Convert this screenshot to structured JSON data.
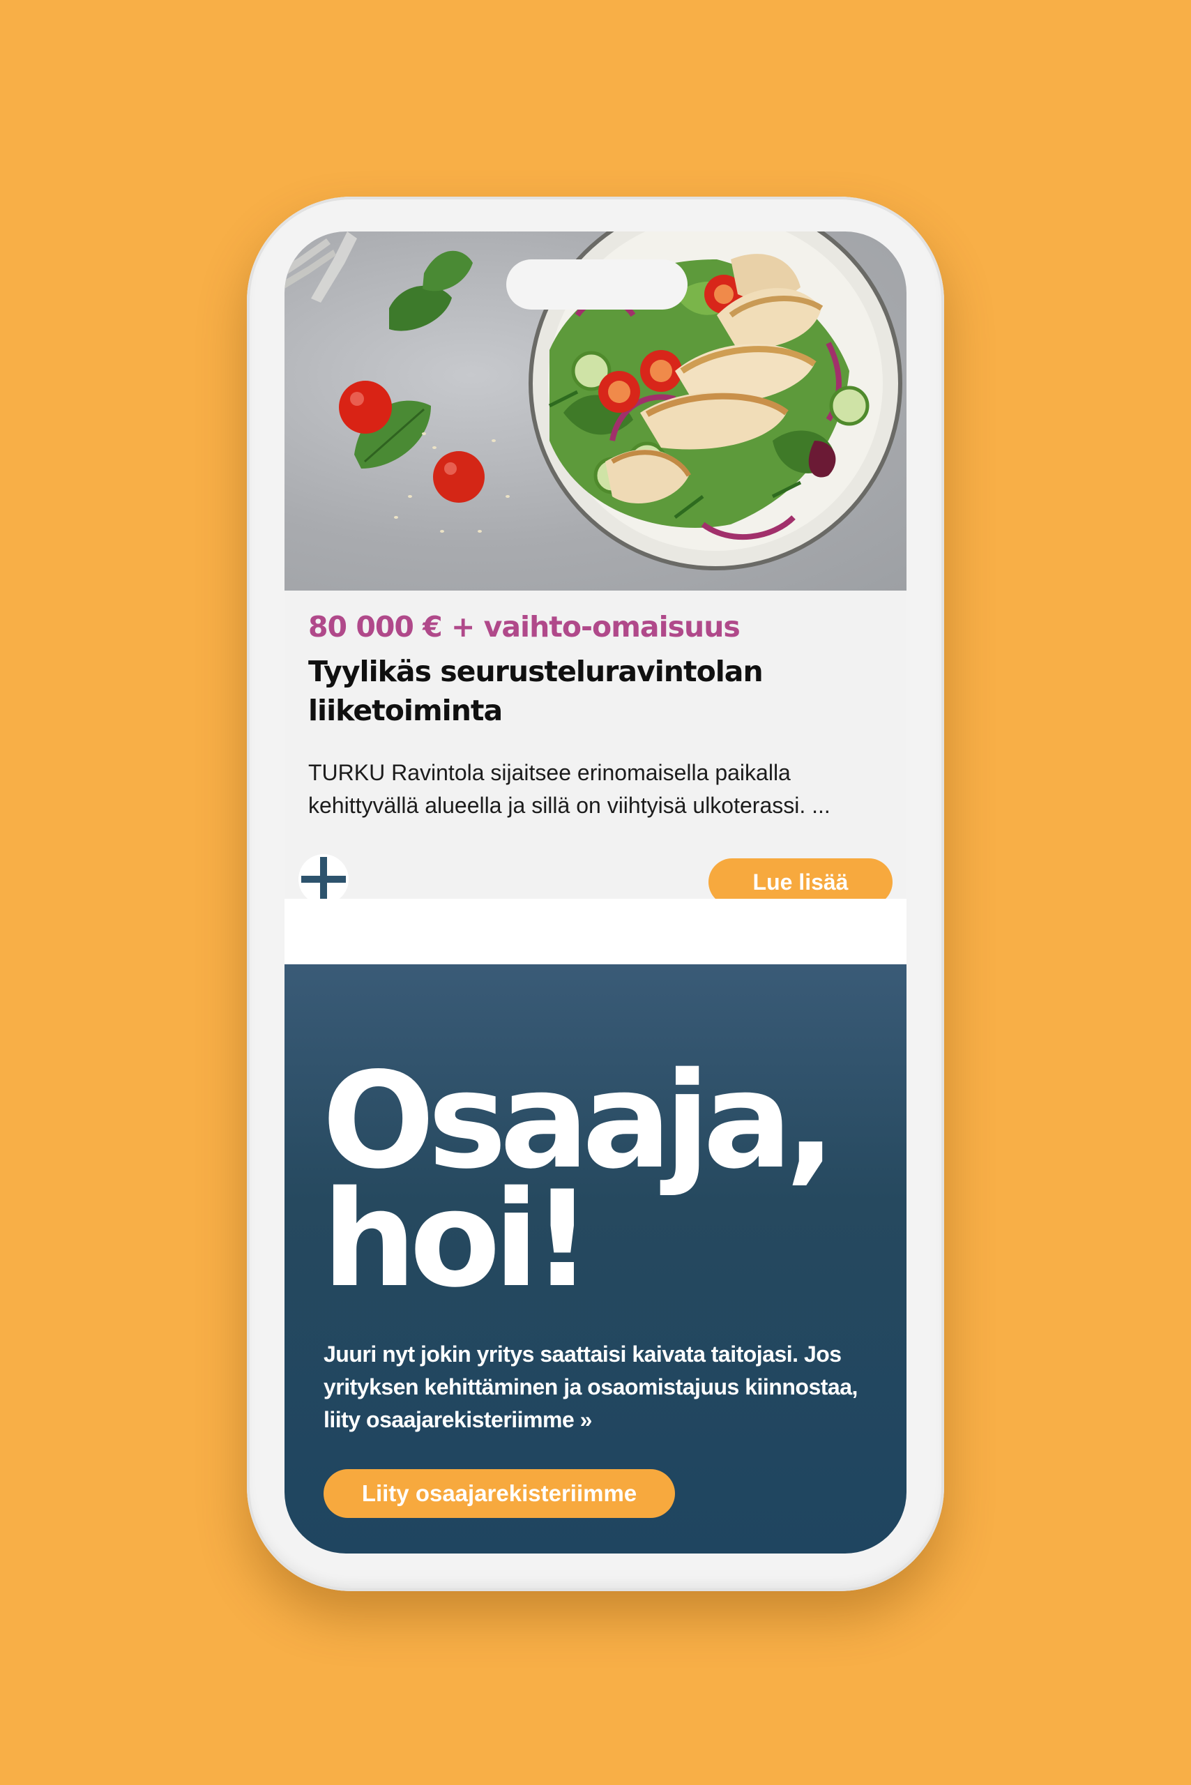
{
  "colors": {
    "background": "#f8af47",
    "price": "#b0498a",
    "accent_button": "#f7a93e",
    "promo_background": "#244a63",
    "plus_icon": "#2d536d"
  },
  "listing_card": {
    "image_icon": "salad-with-chicken-image",
    "price": "80 000 € + vaihto-omaisuus",
    "title": "Tyylikäs seurusteluravintolan liiketoiminta",
    "excerpt": "TURKU Ravintola sijaitsee erinomaisella paikalla kehittyvällä alueella ja sillä on viihtyisä ulkoterassi. ...",
    "favorite_icon": "plus-icon",
    "read_more_label": "Lue lisää"
  },
  "promo": {
    "headline": "Osaaja, hoi!",
    "text": "Juuri nyt jokin yritys saattaisi kaivata taitojasi. Jos yrityksen kehittäminen ja osaomistajuus kiinnostaa, liity osaajarekisteriimme »",
    "button_label": "Liity osaajarekisteriimme"
  }
}
